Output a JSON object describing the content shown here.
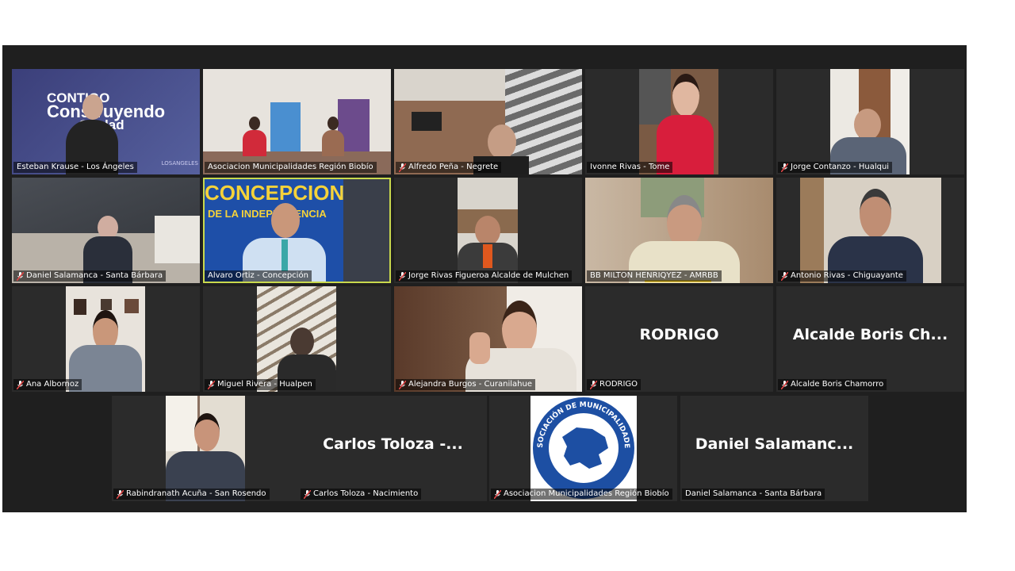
{
  "meeting": {
    "tiles": [
      {
        "name": "Esteban Krause - Los Ángeles",
        "muted": false
      },
      {
        "name": "Asociacion Municipalidades Región Biobío",
        "muted": false
      },
      {
        "name": "Alfredo Peña - Negrete",
        "muted": true
      },
      {
        "name": "Ivonne Rivas - Tome",
        "muted": false
      },
      {
        "name": "Jorge Contanzo - Hualqui",
        "muted": true
      },
      {
        "name": "Daniel Salamanca - Santa Bárbara",
        "muted": true
      },
      {
        "name": "Alvaro Ortiz - Concepción",
        "muted": false,
        "active": true
      },
      {
        "name": "Jorge Rivas Figueroa Alcalde de Mulchen",
        "muted": true
      },
      {
        "name": "BB MILTON HENRIQYEZ - AMRBB",
        "muted": false
      },
      {
        "name": "Antonio Rivas - Chiguayante",
        "muted": true
      },
      {
        "name": "Ana Albornoz",
        "muted": true
      },
      {
        "name": "Miguel Rivera - Hualpen",
        "muted": true
      },
      {
        "name": "Alejandra Burgos - Curanilahue",
        "muted": true
      },
      {
        "name": "RODRIGO",
        "muted": true,
        "display_name": "RODRIGO"
      },
      {
        "name": "Alcalde Boris Chamorro",
        "muted": true,
        "display_name": "Alcalde Boris Ch..."
      },
      {
        "name": "Rabindranath Acuña - San Rosendo",
        "muted": true
      },
      {
        "name": "Carlos Toloza - Nacimiento",
        "muted": true,
        "display_name": "Carlos Toloza -..."
      },
      {
        "name": "Asociacion Municipalidades Región Biobío",
        "muted": true
      },
      {
        "name": "Daniel Salamanca - Santa Bárbara",
        "muted": false,
        "display_name": "Daniel Salamanc..."
      }
    ],
    "backgrounds": {
      "esteban_banner_line1": "CONTIGO",
      "esteban_banner_line2": "Construyendo",
      "esteban_banner_line3": "Ciudad",
      "esteban_logo": "LOSANGELES",
      "alvaro_banner_line1": "CONCEPCION",
      "alvaro_banner_line2": "DE LA INDEPENDENCIA",
      "logo_ring_top": "ASOCIACIÓN DE MUNICIPALIDADES",
      "logo_ring_bottom": "REGIÓN BIO BIO"
    }
  },
  "colors": {
    "stage": "#1f1f1f",
    "tile": "#2b2b2b",
    "active_border": "#c9d94d",
    "mute_icon": "#e04646",
    "logo_blue": "#1d4fa3"
  }
}
